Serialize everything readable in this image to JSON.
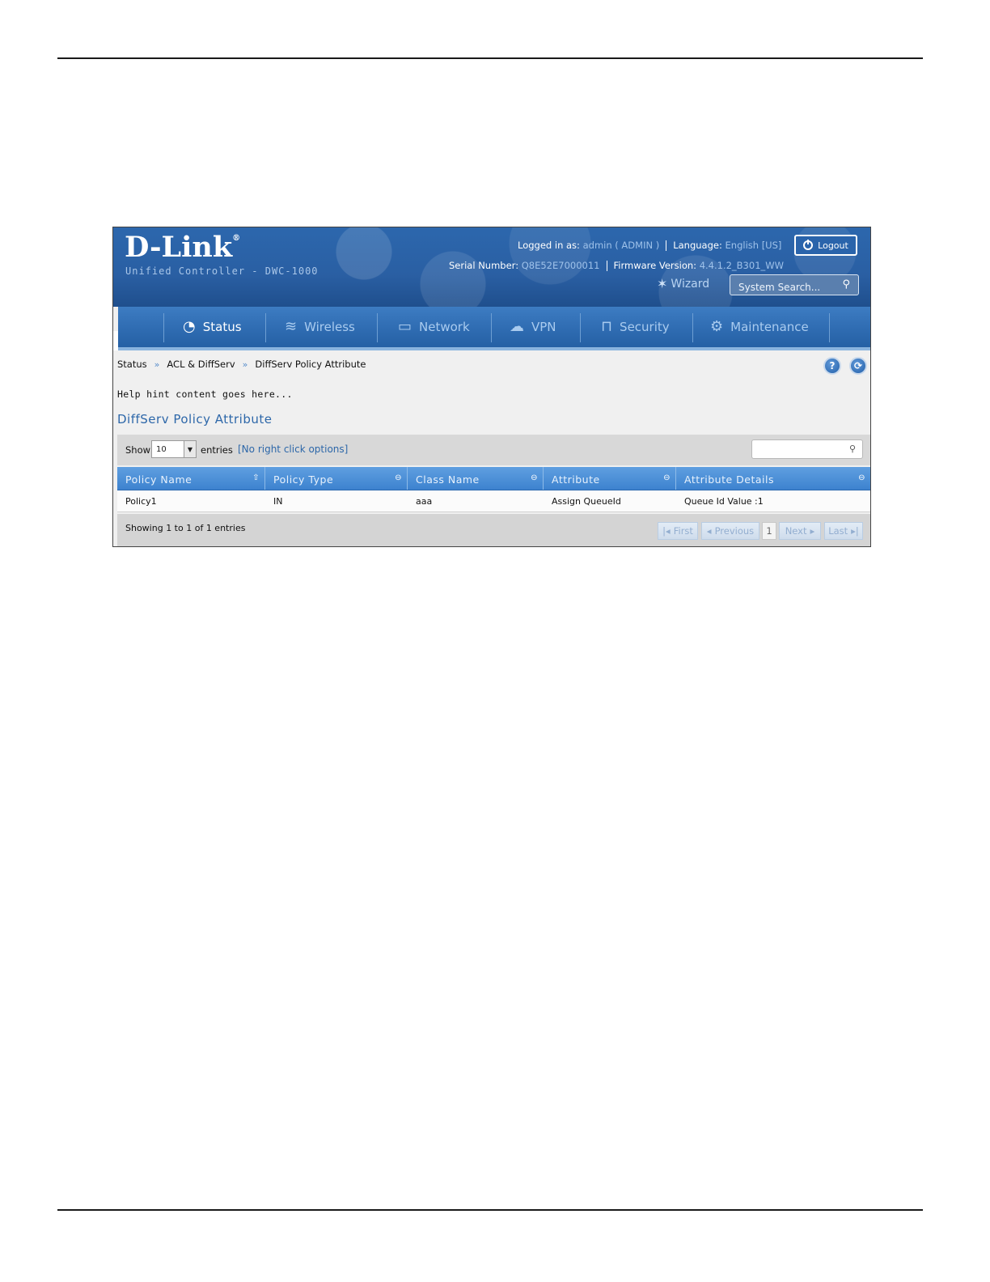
{
  "header": {
    "brand": "D-Link",
    "registered_mark": "®",
    "subtitle": "Unified Controller - DWC-1000",
    "logged_in_label": "Logged in as:",
    "logged_in_user": "admin ( ADMIN )",
    "language_label": "Language:",
    "language_value": "English [US]",
    "logout_label": "Logout",
    "serial_label": "Serial Number:",
    "serial_value": "Q8E52E7000011",
    "firmware_label": "Firmware Version:",
    "firmware_value": "4.4.1.2_B301_WW",
    "wizard_label": "Wizard",
    "search_placeholder": "System Search..."
  },
  "nav": {
    "items": [
      {
        "label": "Status",
        "icon": "gauge-icon",
        "active": true
      },
      {
        "label": "Wireless",
        "icon": "wifi-icon",
        "active": false
      },
      {
        "label": "Network",
        "icon": "computer-icon",
        "active": false
      },
      {
        "label": "VPN",
        "icon": "cloud-lock-icon",
        "active": false
      },
      {
        "label": "Security",
        "icon": "lock-icon",
        "active": false
      },
      {
        "label": "Maintenance",
        "icon": "gears-icon",
        "active": false
      }
    ]
  },
  "breadcrumb": [
    "Status",
    "ACL & DiffServ",
    "DiffServ Policy Attribute"
  ],
  "breadcrumb_separator": "»",
  "help_button": "?",
  "refresh_icon": "refresh-icon",
  "hint": "Help hint content goes here...",
  "section_title": "DiffServ Policy Attribute",
  "table_controls": {
    "show_label": "Show",
    "show_value": "10",
    "entries_label": "entries",
    "right_click": "[No right click options]"
  },
  "table": {
    "columns": [
      "Policy Name",
      "Policy Type",
      "Class Name",
      "Attribute",
      "Attribute Details"
    ],
    "rows": [
      [
        "Policy1",
        "IN",
        "aaa",
        "Assign QueueId",
        "Queue Id Value :1"
      ]
    ]
  },
  "pagination": {
    "summary": "Showing 1 to 1 of 1 entries",
    "first": "First",
    "previous": "Previous",
    "page": "1",
    "next": "Next",
    "last": "Last"
  },
  "colors": {
    "header_blue": "#2a5fa3",
    "nav_blue": "#2f6cb2",
    "accent_link": "#2d67a9",
    "table_header": "#4a8ed6"
  }
}
